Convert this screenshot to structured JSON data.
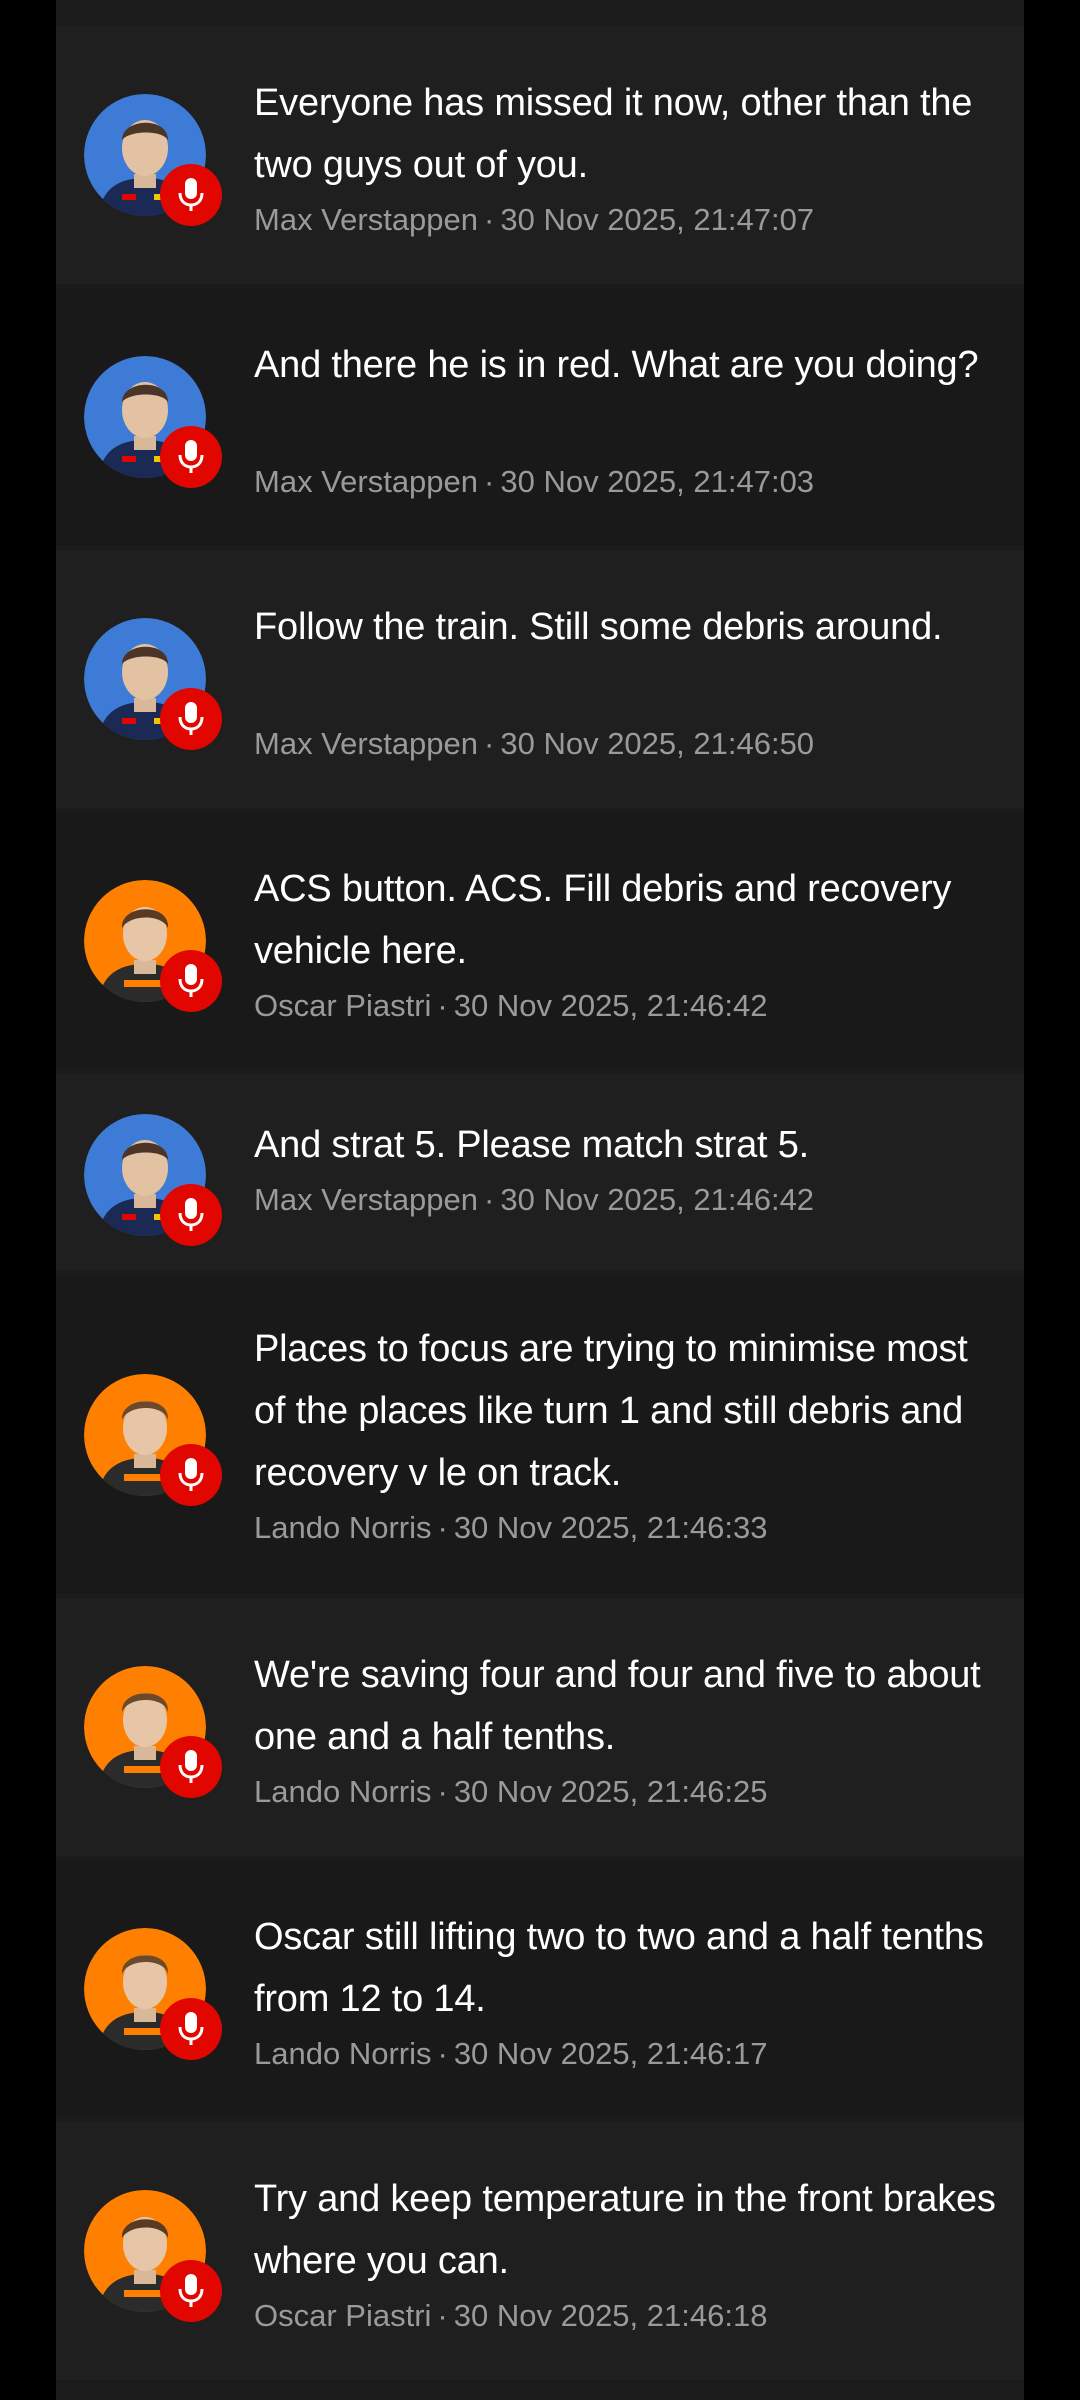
{
  "theme": {
    "page_bg": "#000000",
    "row_bg_a": "#1f1f1f",
    "row_bg_b": "#191919",
    "text": "#ffffff",
    "meta_text": "#9a9a9a",
    "mic_badge": "#e10600",
    "team_redbull": "#3d7bd6",
    "team_mclaren": "#ff8000"
  },
  "separator": "·",
  "messages": [
    {
      "text": "Everyone has missed it now, other than the two guys out of you.",
      "driver": "Max Verstappen",
      "timestamp": "30 Nov 2025, 21:47:07",
      "team": "redbull",
      "icon": "microphone-icon"
    },
    {
      "text": "And there he is in red. What are you doing?",
      "driver": "Max Verstappen",
      "timestamp": "30 Nov 2025, 21:47:03",
      "team": "redbull",
      "icon": "microphone-icon"
    },
    {
      "text": "Follow the train. Still some debris around.",
      "driver": "Max Verstappen",
      "timestamp": "30 Nov 2025, 21:46:50",
      "team": "redbull",
      "icon": "microphone-icon"
    },
    {
      "text": "ACS button. ACS. Fill debris and recovery vehicle here.",
      "driver": "Oscar Piastri",
      "timestamp": "30 Nov 2025, 21:46:42",
      "team": "mclaren",
      "icon": "microphone-icon"
    },
    {
      "text": "And strat 5. Please match strat 5.",
      "driver": "Max Verstappen",
      "timestamp": "30 Nov 2025, 21:46:42",
      "team": "redbull",
      "icon": "microphone-icon"
    },
    {
      "text": "Places to focus are trying to minimise most of the places like turn 1 and still debris and recovery v   le on track.",
      "driver": "Lando Norris",
      "timestamp": "30 Nov 2025, 21:46:33",
      "team": "mclaren",
      "icon": "microphone-icon"
    },
    {
      "text": "We're saving four and four and five to about one and a half tenths.",
      "driver": "Lando Norris",
      "timestamp": "30 Nov 2025, 21:46:25",
      "team": "mclaren",
      "icon": "microphone-icon"
    },
    {
      "text": "Oscar still lifting two to two and a half tenths from 12 to 14.",
      "driver": "Lando Norris",
      "timestamp": "30 Nov 2025, 21:46:17",
      "team": "mclaren",
      "icon": "microphone-icon"
    },
    {
      "text": "Try and keep temperature in the front brakes where you can.",
      "driver": "Oscar Piastri",
      "timestamp": "30 Nov 2025, 21:46:18",
      "team": "mclaren",
      "icon": "microphone-icon"
    }
  ]
}
